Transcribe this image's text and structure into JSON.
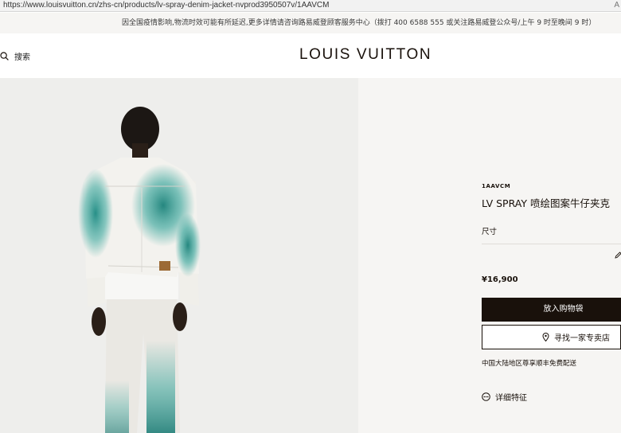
{
  "browser": {
    "url": "https://www.louisvuitton.cn/zhs-cn/products/lv-spray-denim-jacket-nvprod3950507v/1AAVCM",
    "edge_char": "A"
  },
  "notice": {
    "text": "因全国疫情影响,物流时效可能有所延迟,更多详情请咨询路易威登顾客服务中心（拨打 400 6588 555 或关注路易威登公众号/上午 9 时至晚间 9 时）"
  },
  "header": {
    "search_label": "搜索",
    "search_icon": "search-icon",
    "logo": "LOUIS VUITTON"
  },
  "product": {
    "sku": "1AAVCM",
    "title": "LV SPRAY 喷绘图案牛仔夹克",
    "size_label": "尺寸",
    "price": "¥16,900",
    "add_to_bag": "放入购物袋",
    "find_store": "寻找一家专卖店",
    "delivery": "中国大陆地区尊享顺丰免费配送",
    "details": "详细特征"
  },
  "colors": {
    "brand_dark": "#19110b",
    "panel_bg": "#f6f5f3",
    "spray_teal": "#2e9f95"
  }
}
